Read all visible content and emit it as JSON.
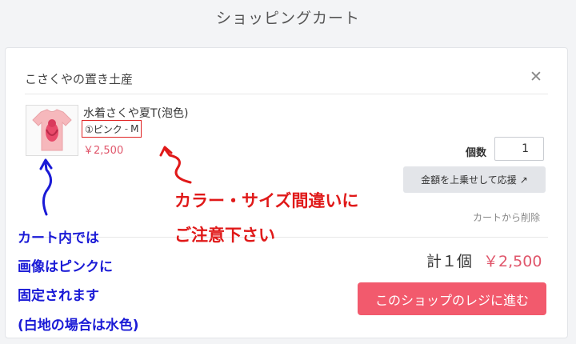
{
  "header": {
    "title": "ショッピングカート"
  },
  "shop": {
    "name": "こさくやの置き土産"
  },
  "item": {
    "name": "水着さくや夏T(泡色)",
    "color": "①ピンク",
    "separator": "-",
    "size": "M",
    "price": "￥2,500",
    "thumbnail_icon": "pink-tshirt-image"
  },
  "quantity": {
    "label": "個数",
    "value": "1"
  },
  "buttons": {
    "boost": "金額を上乗せして応援",
    "boost_icon": "external-arrow-icon",
    "delete": "カートから削除",
    "checkout": "このショップのレジに進む"
  },
  "total": {
    "label": "計１個",
    "price": "￥2,500"
  },
  "annotations": {
    "red_line1": "カラー・サイズ間違いに",
    "red_line2": "ご注意下さい",
    "blue_line1": "カート内では",
    "blue_line2": "画像はピンクに",
    "blue_line3": "固定されます",
    "blue_line4": "(白地の場合は水色)"
  },
  "colors": {
    "accent": "#f25a6d",
    "price": "#e0566b",
    "annotation_red": "#e01919",
    "annotation_blue": "#1a1ad6"
  }
}
